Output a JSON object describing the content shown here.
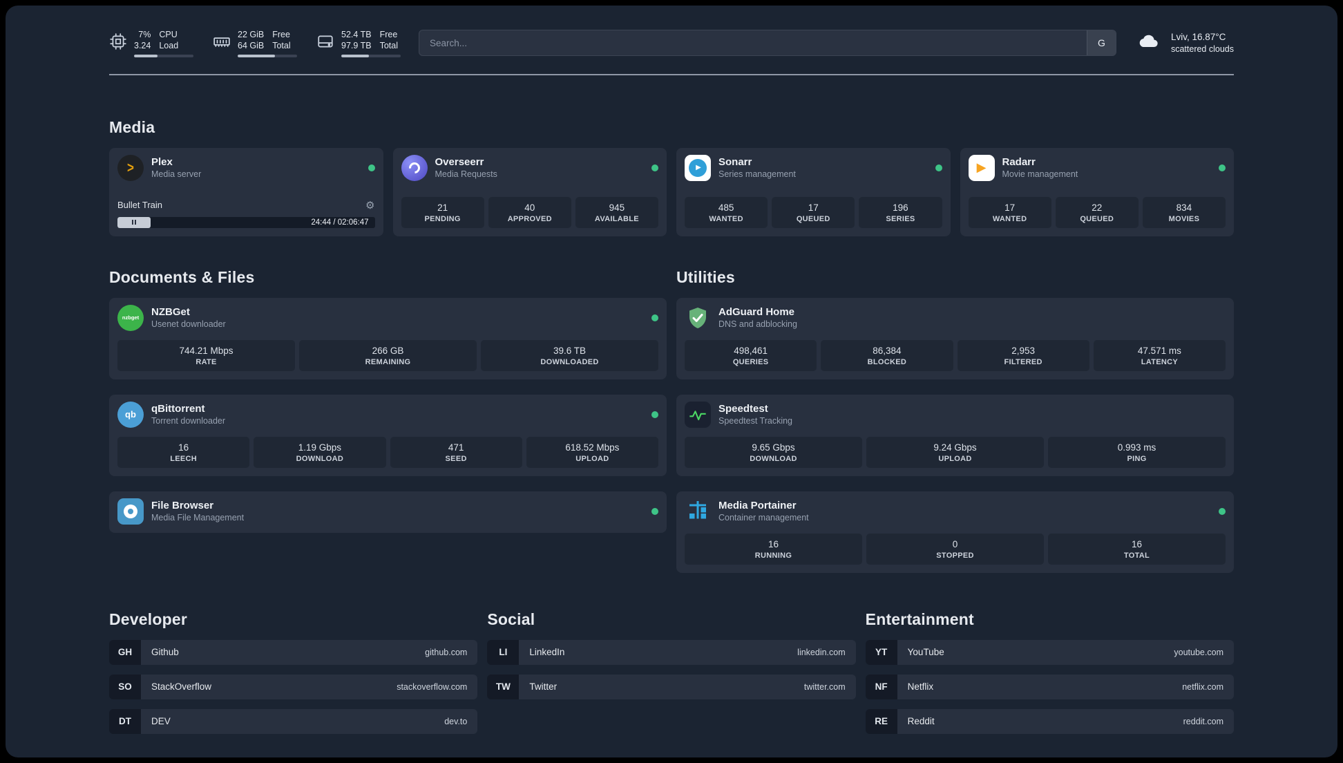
{
  "colors": {
    "status_online": "#3ec487",
    "plex_orange": "#e5a00d",
    "overseerr_purple": "#5a5fd8",
    "sonarr_blue": "#2f9fd8",
    "radarr_orange": "#f7a421",
    "nzbget_green": "#3cb44a",
    "qbittorrent_blue": "#4b9fd6",
    "adguard_green": "#67b279",
    "speedtest_line_green": "#4cd964",
    "portainer_blue": "#2fa8e1"
  },
  "header": {
    "cpu": {
      "value_top": "7%",
      "value_bottom": "3.24",
      "label_top": "CPU",
      "label_bottom": "Load",
      "progress_percent": 40
    },
    "memory": {
      "value_top": "22 GiB",
      "value_bottom": "64 GiB",
      "label_top": "Free",
      "label_bottom": "Total",
      "progress_percent": 63
    },
    "disk": {
      "value_top": "52.4 TB",
      "value_bottom": "97.9 TB",
      "label_top": "Free",
      "label_bottom": "Total",
      "progress_percent": 47
    },
    "search": {
      "placeholder": "Search...",
      "provider_button": "G"
    },
    "weather": {
      "location": "Lviv, 16.87°C",
      "condition": "scattered clouds"
    }
  },
  "sections": {
    "media": {
      "title": "Media"
    },
    "documents": {
      "title": "Documents & Files"
    },
    "utilities": {
      "title": "Utilities"
    },
    "developer": {
      "title": "Developer"
    },
    "social": {
      "title": "Social"
    },
    "entertainment": {
      "title": "Entertainment"
    }
  },
  "services": {
    "plex": {
      "name": "Plex",
      "desc": "Media server",
      "glyph": ">",
      "now_playing": "Bullet Train",
      "settings_icon": "⚙",
      "time": "24:44 / 02:06:47"
    },
    "overseerr": {
      "name": "Overseerr",
      "desc": "Media Requests",
      "stats": [
        {
          "value": "21",
          "label": "PENDING"
        },
        {
          "value": "40",
          "label": "APPROVED"
        },
        {
          "value": "945",
          "label": "AVAILABLE"
        }
      ]
    },
    "sonarr": {
      "name": "Sonarr",
      "desc": "Series management",
      "glyph": "▶",
      "stats": [
        {
          "value": "485",
          "label": "WANTED"
        },
        {
          "value": "17",
          "label": "QUEUED"
        },
        {
          "value": "196",
          "label": "SERIES"
        }
      ]
    },
    "radarr": {
      "name": "Radarr",
      "desc": "Movie management",
      "glyph": "▶",
      "stats": [
        {
          "value": "17",
          "label": "WANTED"
        },
        {
          "value": "22",
          "label": "QUEUED"
        },
        {
          "value": "834",
          "label": "MOVIES"
        }
      ]
    },
    "nzbget": {
      "name": "NZBGet",
      "desc": "Usenet downloader",
      "glyph": "nzbget",
      "stats": [
        {
          "value": "744.21 Mbps",
          "label": "RATE"
        },
        {
          "value": "266 GB",
          "label": "REMAINING"
        },
        {
          "value": "39.6 TB",
          "label": "DOWNLOADED"
        }
      ]
    },
    "qbittorrent": {
      "name": "qBittorrent",
      "desc": "Torrent downloader",
      "glyph": "qb",
      "stats": [
        {
          "value": "16",
          "label": "LEECH"
        },
        {
          "value": "1.19 Gbps",
          "label": "DOWNLOAD"
        },
        {
          "value": "471",
          "label": "SEED"
        },
        {
          "value": "618.52 Mbps",
          "label": "UPLOAD"
        }
      ]
    },
    "filebrowser": {
      "name": "File Browser",
      "desc": "Media File Management"
    },
    "adguard": {
      "name": "AdGuard Home",
      "desc": "DNS and adblocking",
      "stats": [
        {
          "value": "498,461",
          "label": "QUERIES"
        },
        {
          "value": "86,384",
          "label": "BLOCKED"
        },
        {
          "value": "2,953",
          "label": "FILTERED"
        },
        {
          "value": "47.571 ms",
          "label": "LATENCY"
        }
      ]
    },
    "speedtest": {
      "name": "Speedtest",
      "desc": "Speedtest Tracking",
      "stats": [
        {
          "value": "9.65 Gbps",
          "label": "DOWNLOAD"
        },
        {
          "value": "9.24 Gbps",
          "label": "UPLOAD"
        },
        {
          "value": "0.993 ms",
          "label": "PING"
        }
      ]
    },
    "portainer": {
      "name": "Media Portainer",
      "desc": "Container management",
      "stats": [
        {
          "value": "16",
          "label": "RUNNING"
        },
        {
          "value": "0",
          "label": "STOPPED"
        },
        {
          "value": "16",
          "label": "TOTAL"
        }
      ]
    }
  },
  "bookmarks": {
    "developer": [
      {
        "abbr": "GH",
        "name": "Github",
        "url": "github.com"
      },
      {
        "abbr": "SO",
        "name": "StackOverflow",
        "url": "stackoverflow.com"
      },
      {
        "abbr": "DT",
        "name": "DEV",
        "url": "dev.to"
      }
    ],
    "social": [
      {
        "abbr": "LI",
        "name": "LinkedIn",
        "url": "linkedin.com"
      },
      {
        "abbr": "TW",
        "name": "Twitter",
        "url": "twitter.com"
      }
    ],
    "entertainment": [
      {
        "abbr": "YT",
        "name": "YouTube",
        "url": "youtube.com"
      },
      {
        "abbr": "NF",
        "name": "Netflix",
        "url": "netflix.com"
      },
      {
        "abbr": "RE",
        "name": "Reddit",
        "url": "reddit.com"
      }
    ]
  }
}
